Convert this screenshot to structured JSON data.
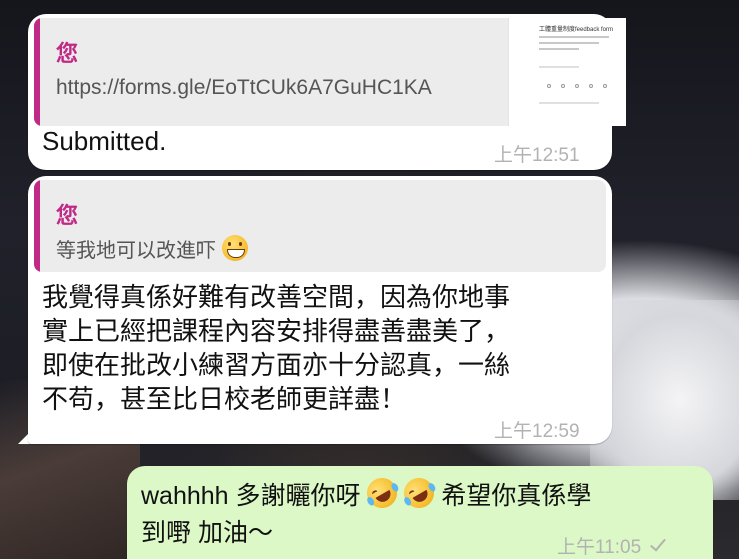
{
  "messages": [
    {
      "direction": "incoming",
      "quote": {
        "author": "您",
        "text": "https://forms.gle/EoTtCUk6A7GuHC1KA"
      },
      "link_preview_title": "工體重量制度feedback form",
      "body": "Submitted.",
      "time": "上午12:51"
    },
    {
      "direction": "incoming",
      "quote": {
        "author": "您",
        "text": "等我地可以改進吓",
        "emoji": "grinning-face-with-smiling-eyes"
      },
      "body_lines": [
        "我覺得真係好難有改善空間，因為你地事",
        "實上已經把課程內容安排得盡善盡美了，",
        "即使在批改小練習方面亦十分認真，一絲",
        "不苟，甚至比日校老師更詳盡！"
      ],
      "time": "上午12:59"
    },
    {
      "direction": "outgoing",
      "body_line1_a": "wahhhh 多謝曬你呀",
      "body_line1_b": "希望你真係學",
      "body_line2": "到嘢 加油～",
      "emojis": [
        "rolling-on-floor-laughing",
        "rolling-on-floor-laughing"
      ],
      "time": "上午11:05",
      "status": "sent"
    }
  ],
  "colors": {
    "incoming_bubble": "#ffffff",
    "outgoing_bubble": "#dcf8c6",
    "quote_accent": "#c02a86",
    "timestamp": "#b2b2b2"
  }
}
